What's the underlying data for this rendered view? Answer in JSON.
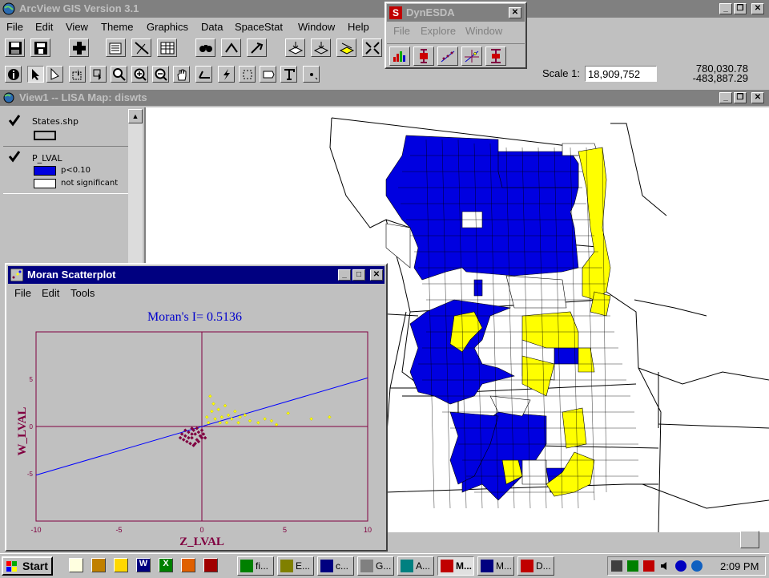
{
  "app": {
    "title": "ArcView GIS Version 3.1",
    "menu": [
      "File",
      "Edit",
      "View",
      "Theme",
      "Graphics",
      "Data",
      "SpaceStat",
      "Window",
      "Help"
    ],
    "scale_label": "Scale 1:",
    "scale_value": "18,909,752",
    "coord_x": "780,030.78",
    "coord_y": "-483,887.29"
  },
  "dynesda": {
    "title": "DynESDA",
    "icon_letter": "S",
    "menu": [
      "File",
      "Explore",
      "Window"
    ]
  },
  "view": {
    "title": "View1 -- LISA Map: diswts",
    "legend": {
      "theme1": {
        "name": "States.shp"
      },
      "theme2": {
        "name": "P_LVAL",
        "items": [
          {
            "label": "p<0.10",
            "color": "#0000e0"
          },
          {
            "label": "not significant",
            "color": "#ffffff"
          }
        ]
      }
    }
  },
  "moran": {
    "title": "Moran Scatterplot",
    "menu": [
      "File",
      "Edit",
      "Tools"
    ],
    "statistic": "Moran's I= 0.5136",
    "xlabel": "Z_LVAL",
    "ylabel": "W_LVAL"
  },
  "chart_data": {
    "type": "scatter",
    "title": "Moran's I= 0.5136",
    "xlabel": "Z_LVAL",
    "ylabel": "W_LVAL",
    "xlim": [
      -10,
      10
    ],
    "ylim": [
      -5,
      5
    ],
    "x_ticks": [
      "-10",
      "-5",
      "0",
      "5",
      "10"
    ],
    "y_ticks": [
      "5",
      "0",
      "-5"
    ],
    "slope": 0.5136,
    "regression_color": "#0000ff",
    "axis_color": "#800040",
    "series": [
      {
        "color": "#800040",
        "points": [
          [
            -1.2,
            -0.4
          ],
          [
            -1.0,
            -0.5
          ],
          [
            -0.8,
            -0.3
          ],
          [
            -0.6,
            -0.6
          ],
          [
            -0.5,
            -0.2
          ],
          [
            -0.4,
            -0.4
          ],
          [
            -0.3,
            -0.7
          ],
          [
            -0.2,
            -0.3
          ],
          [
            -0.1,
            -0.5
          ],
          [
            0.0,
            -0.2
          ],
          [
            -0.9,
            -0.8
          ],
          [
            -0.7,
            -0.9
          ],
          [
            -0.5,
            -1.0
          ],
          [
            -1.1,
            -0.7
          ],
          [
            -0.6,
            -0.1
          ],
          [
            -0.3,
            -0.1
          ],
          [
            0.1,
            -0.4
          ],
          [
            0.2,
            -0.6
          ],
          [
            -1.3,
            -0.6
          ],
          [
            -0.8,
            -0.6
          ],
          [
            -0.4,
            -0.9
          ],
          [
            -0.2,
            -0.8
          ],
          [
            0.0,
            -0.6
          ],
          [
            -0.6,
            -0.4
          ],
          [
            -1.0,
            -0.2
          ]
        ]
      },
      {
        "color": "#ffff00",
        "points": [
          [
            0.3,
            0.5
          ],
          [
            0.6,
            0.8
          ],
          [
            0.8,
            0.4
          ],
          [
            1.0,
            0.9
          ],
          [
            1.2,
            0.5
          ],
          [
            1.4,
            1.1
          ],
          [
            1.6,
            0.6
          ],
          [
            1.8,
            0.4
          ],
          [
            2.0,
            0.8
          ],
          [
            2.3,
            0.5
          ],
          [
            2.6,
            0.6
          ],
          [
            2.9,
            0.3
          ],
          [
            3.4,
            0.2
          ],
          [
            3.8,
            0.4
          ],
          [
            4.2,
            0.3
          ],
          [
            5.2,
            0.7
          ],
          [
            6.6,
            0.4
          ],
          [
            7.7,
            0.5
          ],
          [
            0.5,
            1.6
          ],
          [
            0.7,
            1.2
          ],
          [
            1.1,
            0.2
          ],
          [
            0.4,
            0.2
          ],
          [
            1.5,
            0.2
          ],
          [
            2.2,
            0.2
          ],
          [
            4.5,
            0.1
          ]
        ]
      }
    ]
  },
  "taskbar": {
    "start": "Start",
    "clock": "2:09 PM",
    "buttons": [
      {
        "label": "fi...",
        "color": "#008000"
      },
      {
        "label": "E...",
        "color": "#808000"
      },
      {
        "label": "c...",
        "color": "#000080"
      },
      {
        "label": "G...",
        "color": "#808080"
      },
      {
        "label": "A...",
        "color": "#008080"
      },
      {
        "label": "M...",
        "color": "#c00000"
      },
      {
        "label": "M...",
        "color": "#000080"
      },
      {
        "label": "D...",
        "color": "#c00000"
      }
    ]
  }
}
